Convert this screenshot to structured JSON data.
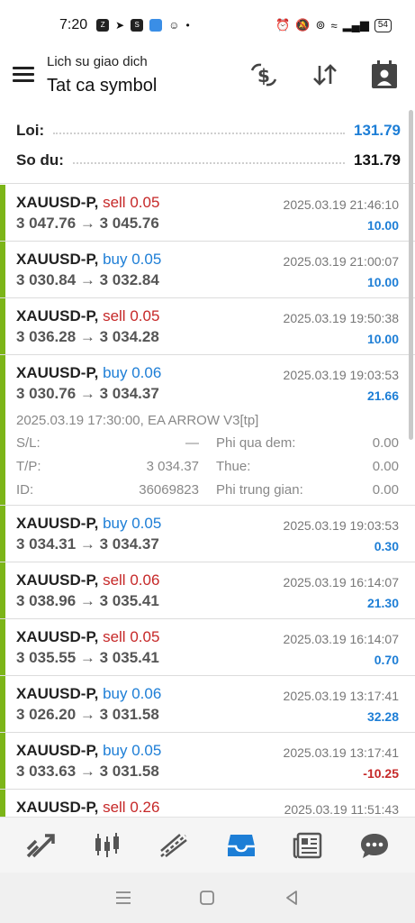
{
  "status_bar": {
    "time": "7:20",
    "battery": "54"
  },
  "header": {
    "subtitle": "Lich su giao dich",
    "title": "Tat ca symbol"
  },
  "summary": {
    "profit_label": "Loi:",
    "profit_value": "131.79",
    "balance_label": "So du:",
    "balance_value": "131.79"
  },
  "deals": [
    {
      "symbol": "XAUUSD-P,",
      "side": "sell",
      "volume": "0.05",
      "prices": "3 047.76 → 3 045.76",
      "time": "2025.03.19 21:46:10",
      "profit": "10.00"
    },
    {
      "symbol": "XAUUSD-P,",
      "side": "buy",
      "volume": "0.05",
      "prices": "3 030.84 → 3 032.84",
      "time": "2025.03.19 21:00:07",
      "profit": "10.00"
    },
    {
      "symbol": "XAUUSD-P,",
      "side": "sell",
      "volume": "0.05",
      "prices": "3 036.28 → 3 034.28",
      "time": "2025.03.19 19:50:38",
      "profit": "10.00"
    },
    {
      "symbol": "XAUUSD-P,",
      "side": "buy",
      "volume": "0.06",
      "prices": "3 030.76 → 3 034.37",
      "time": "2025.03.19 19:03:53",
      "profit": "21.66"
    },
    {
      "symbol": "XAUUSD-P,",
      "side": "buy",
      "volume": "0.05",
      "prices": "3 034.31 → 3 034.37",
      "time": "2025.03.19 19:03:53",
      "profit": "0.30"
    },
    {
      "symbol": "XAUUSD-P,",
      "side": "sell",
      "volume": "0.06",
      "prices": "3 038.96 → 3 035.41",
      "time": "2025.03.19 16:14:07",
      "profit": "21.30"
    },
    {
      "symbol": "XAUUSD-P,",
      "side": "sell",
      "volume": "0.05",
      "prices": "3 035.55 → 3 035.41",
      "time": "2025.03.19 16:14:07",
      "profit": "0.70"
    },
    {
      "symbol": "XAUUSD-P,",
      "side": "buy",
      "volume": "0.06",
      "prices": "3 026.20 → 3 031.58",
      "time": "2025.03.19 13:17:41",
      "profit": "32.28"
    },
    {
      "symbol": "XAUUSD-P,",
      "side": "buy",
      "volume": "0.05",
      "prices": "3 033.63 → 3 031.58",
      "time": "2025.03.19 13:17:41",
      "profit": "-10.25"
    },
    {
      "symbol": "XAUUSD-P,",
      "side": "sell",
      "volume": "0.26",
      "prices": "",
      "time": "2025.03.19 11:51:43",
      "profit": ""
    }
  ],
  "expanded_detail": {
    "open_info": "2025.03.19 17:30:00, EA ARROW V3[tp]",
    "sl_label": "S/L:",
    "sl_value": "—",
    "tp_label": "T/P:",
    "tp_value": "3 034.37",
    "id_label": "ID:",
    "id_value": "36069823",
    "swap_label": "Phi qua dem:",
    "swap_value": "0.00",
    "tax_label": "Thue:",
    "tax_value": "0.00",
    "commission_label": "Phi trung gian:",
    "commission_value": "0.00"
  },
  "colors": {
    "accent_blue": "#1d7ed6",
    "sell_red": "#c62828",
    "bar_green": "#7cb518"
  },
  "tabs": [
    "quotes-icon",
    "chart-icon",
    "trade-icon",
    "history-icon",
    "news-icon",
    "chat-icon"
  ]
}
